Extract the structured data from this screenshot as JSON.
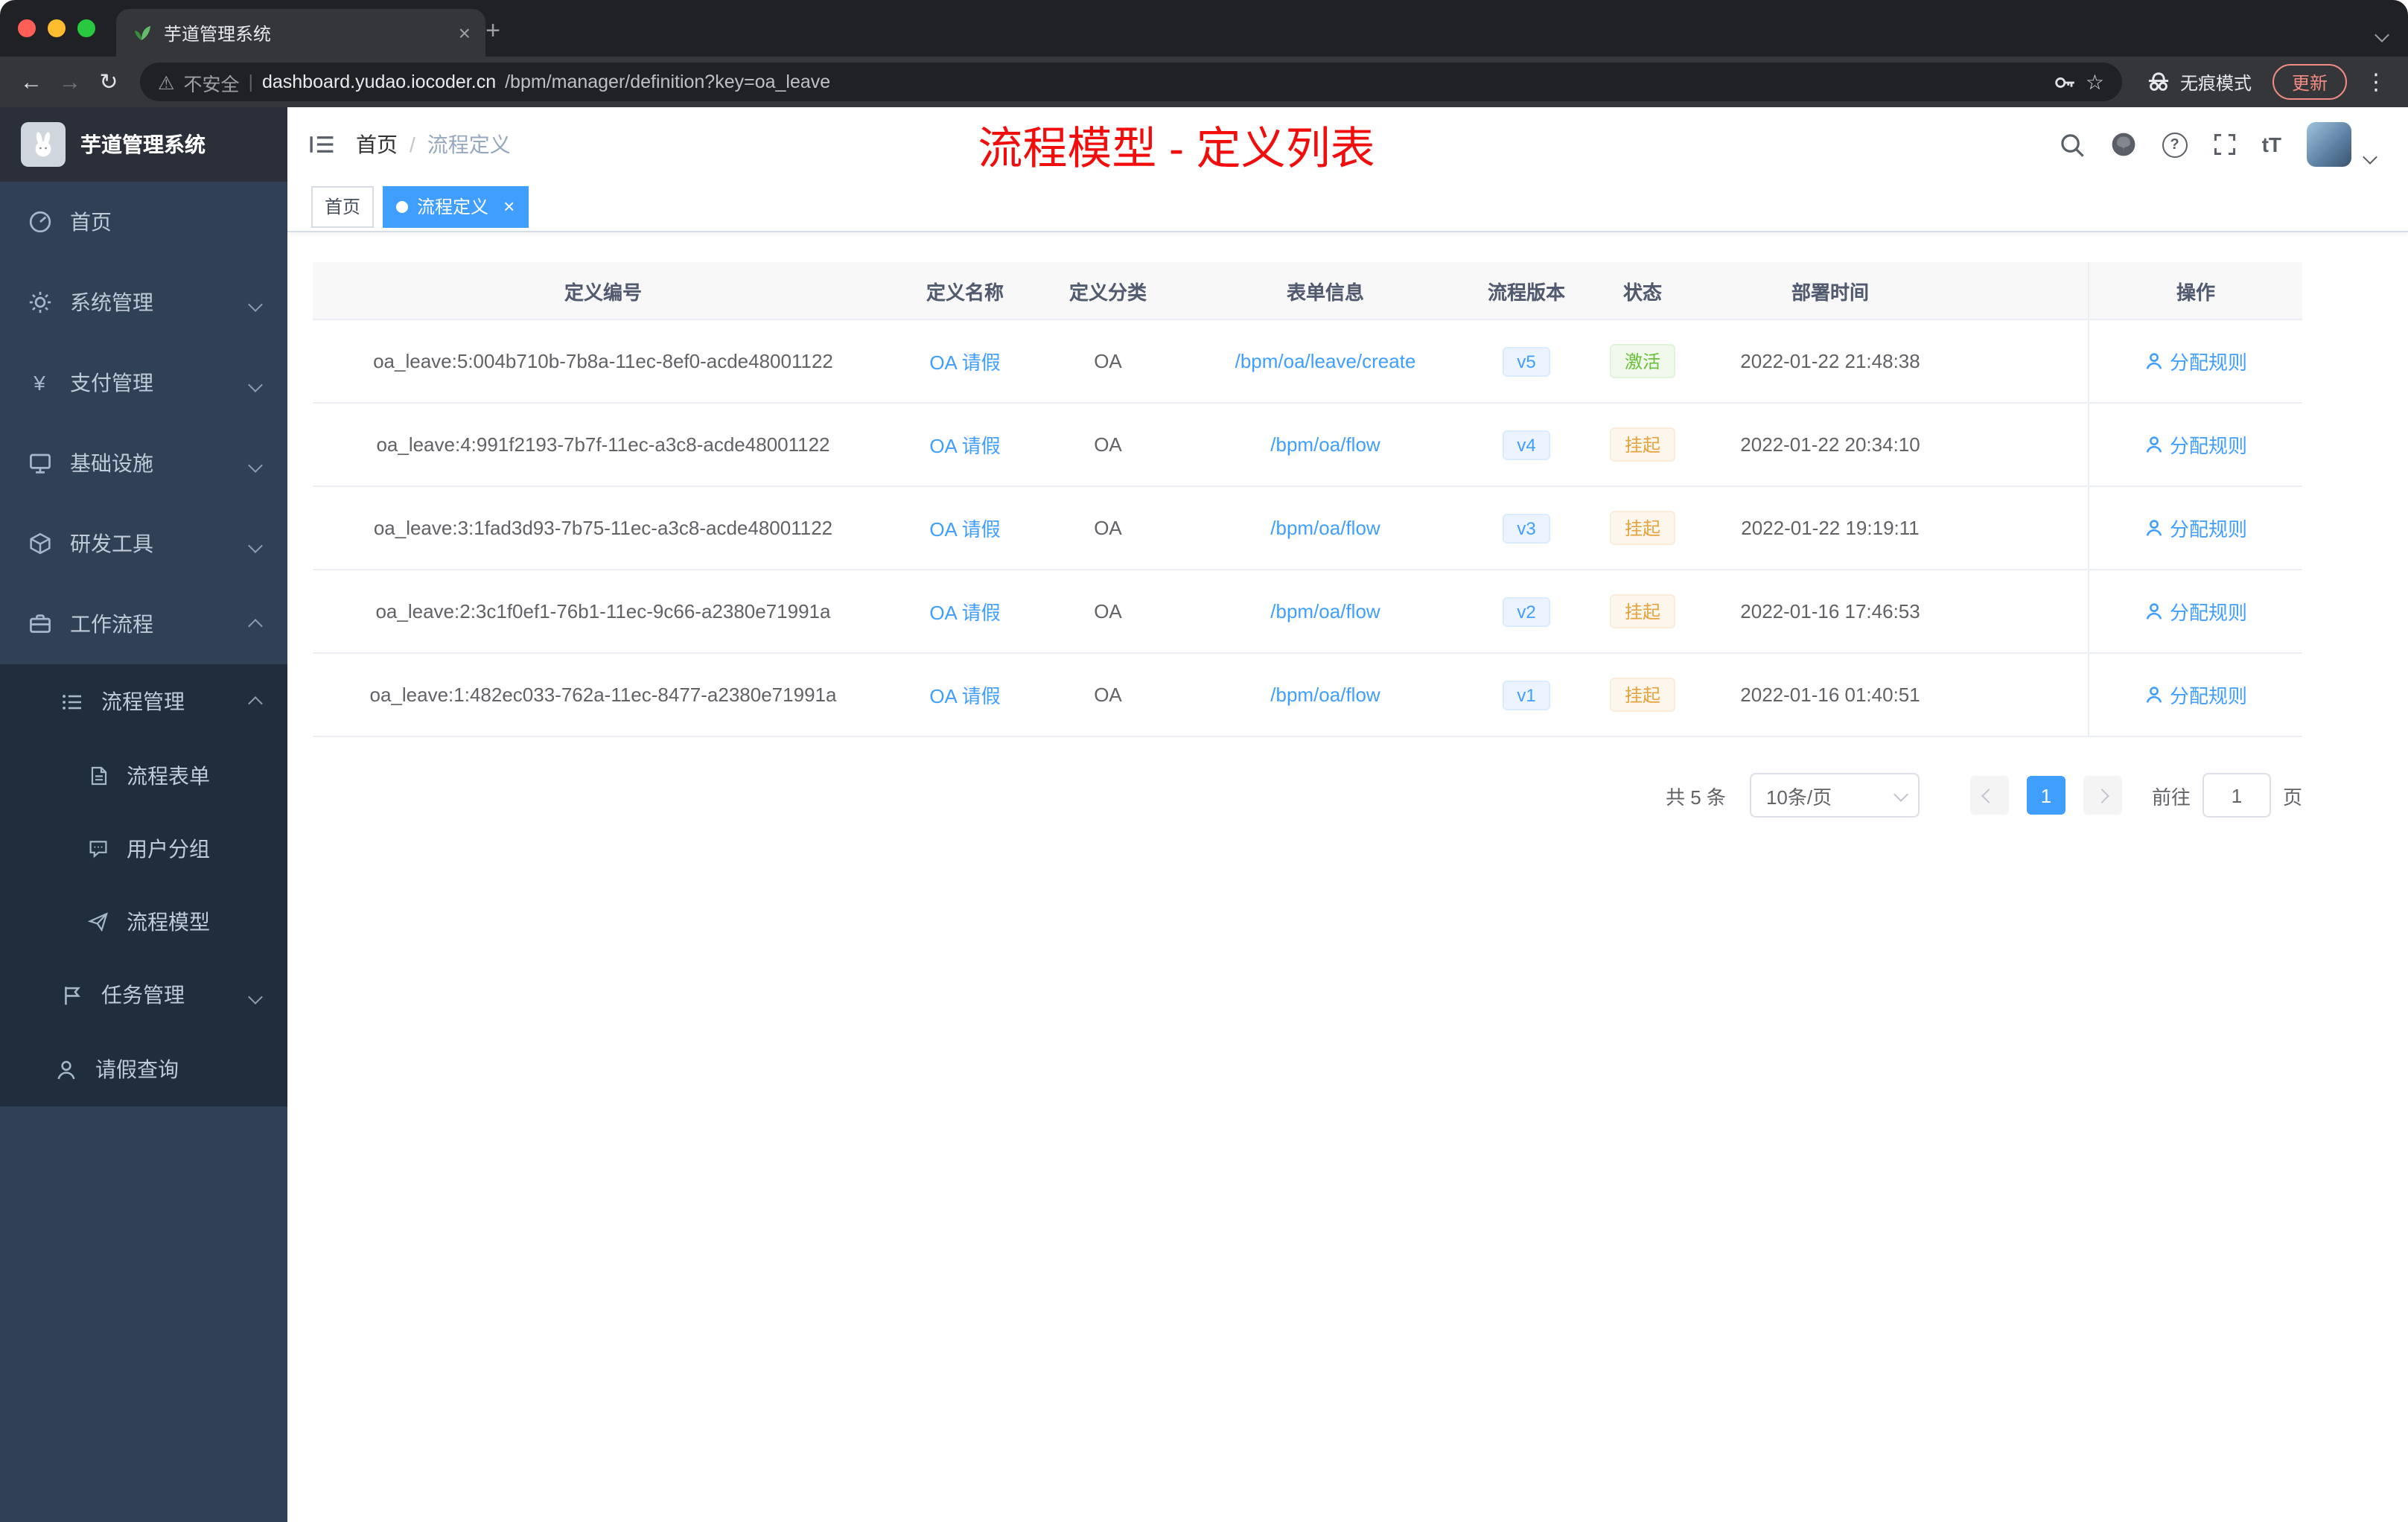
{
  "glyphs": {
    "back": "←",
    "forward": "→",
    "reload": "↻",
    "warning": "⚠",
    "divider": "|",
    "star": "☆",
    "more": "⋮",
    "close": "×",
    "plus": "+",
    "slash": "/",
    "question": "?",
    "tT": "tT"
  },
  "colors": {
    "accent": "#409eff",
    "success": "#67c23a",
    "warning": "#e6a23c",
    "annotation_red": "#f20d0d",
    "sidebar_bg": "#304156"
  },
  "browser": {
    "tab_title": "芋道管理系统",
    "security_label": "不安全",
    "url_host": "dashboard.yudao.iocoder.cn",
    "url_path": "/bpm/manager/definition?key=oa_leave",
    "incognito_label": "无痕模式",
    "update_label": "更新"
  },
  "sidebar": {
    "title": "芋道管理系统",
    "items": [
      "首页",
      "系统管理",
      "支付管理",
      "基础设施",
      "研发工具",
      "工作流程"
    ],
    "submenu": {
      "process_mgmt": "流程管理",
      "process_children": [
        "流程表单",
        "用户分组",
        "流程模型"
      ],
      "task_mgmt": "任务管理",
      "leave_query": "请假查询"
    }
  },
  "header": {
    "breadcrumb_home": "首页",
    "breadcrumb_current": "流程定义",
    "annotation": "流程模型 - 定义列表"
  },
  "tags": {
    "home": "首页",
    "active": "流程定义"
  },
  "table": {
    "columns": [
      "定义编号",
      "定义名称",
      "定义分类",
      "表单信息",
      "流程版本",
      "状态",
      "部署时间",
      "操作"
    ],
    "rows": [
      {
        "id": "oa_leave:5:004b710b-7b8a-11ec-8ef0-acde48001122",
        "name": "OA 请假",
        "category": "OA",
        "form": "/bpm/oa/leave/create",
        "version": "v5",
        "status": "激活",
        "time": "2022-01-22 21:48:38",
        "action": "分配规则"
      },
      {
        "id": "oa_leave:4:991f2193-7b7f-11ec-a3c8-acde48001122",
        "name": "OA 请假",
        "category": "OA",
        "form": "/bpm/oa/flow",
        "version": "v4",
        "status": "挂起",
        "time": "2022-01-22 20:34:10",
        "action": "分配规则"
      },
      {
        "id": "oa_leave:3:1fad3d93-7b75-11ec-a3c8-acde48001122",
        "name": "OA 请假",
        "category": "OA",
        "form": "/bpm/oa/flow",
        "version": "v3",
        "status": "挂起",
        "time": "2022-01-22 19:19:11",
        "action": "分配规则"
      },
      {
        "id": "oa_leave:2:3c1f0ef1-76b1-11ec-9c66-a2380e71991a",
        "name": "OA 请假",
        "category": "OA",
        "form": "/bpm/oa/flow",
        "version": "v2",
        "status": "挂起",
        "time": "2022-01-16 17:46:53",
        "action": "分配规则"
      },
      {
        "id": "oa_leave:1:482ec033-762a-11ec-8477-a2380e71991a",
        "name": "OA 请假",
        "category": "OA",
        "form": "/bpm/oa/flow",
        "version": "v1",
        "status": "挂起",
        "time": "2022-01-16 01:40:51",
        "action": "分配规则"
      }
    ]
  },
  "pagination": {
    "total": "共 5 条",
    "page_size": "10条/页",
    "current_page": "1",
    "goto_label": "前往",
    "goto_value": "1",
    "page_label": "页"
  }
}
